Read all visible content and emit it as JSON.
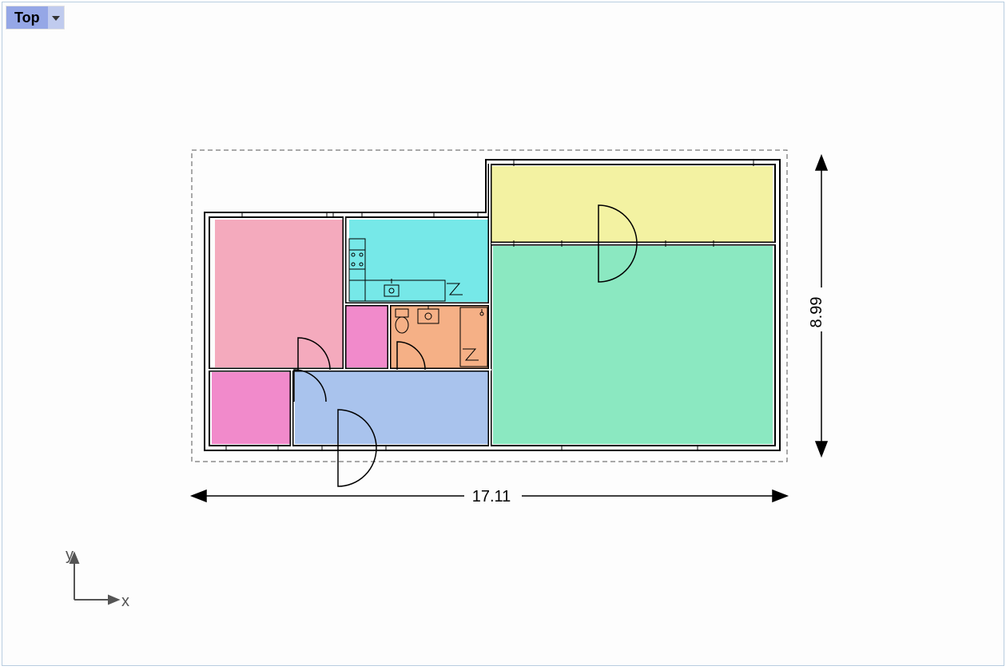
{
  "view": {
    "label": "Top"
  },
  "axes": {
    "x_label": "x",
    "y_label": "y"
  },
  "dimensions": {
    "width_label": "17.11",
    "height_label": "8.99"
  },
  "rooms": {
    "pink_large": {
      "color": "#f4aabd"
    },
    "magenta_small": {
      "color": "#f18acb"
    },
    "magenta_bottom": {
      "color": "#f18acb"
    },
    "cyan": {
      "color": "#76e8e8"
    },
    "orange": {
      "color": "#f5b086"
    },
    "blue": {
      "color": "#a9c3ed"
    },
    "yellow": {
      "color": "#f3f2a2"
    },
    "green_large": {
      "color": "#8be8c1"
    }
  }
}
